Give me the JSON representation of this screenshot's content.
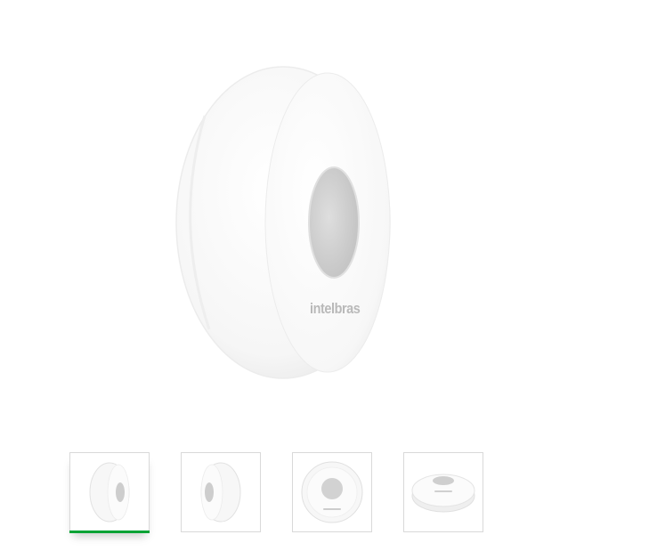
{
  "product": {
    "brand_mark": "intelbras",
    "main_image_icon": "alarm-button-device-icon"
  },
  "gallery": {
    "selected_index": 0,
    "accent_color": "#00a335",
    "thumbnails": [
      {
        "view": "side-angle",
        "icon": "device-side-angle-icon"
      },
      {
        "view": "side-angle-alt",
        "icon": "device-side-alt-icon"
      },
      {
        "view": "front",
        "icon": "device-front-icon"
      },
      {
        "view": "top-perspective",
        "icon": "device-top-icon"
      }
    ]
  }
}
